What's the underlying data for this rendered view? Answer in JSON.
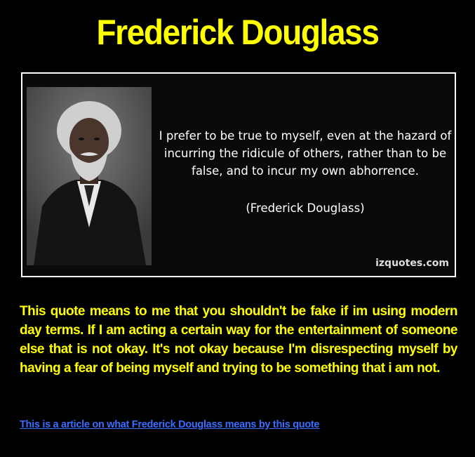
{
  "title": "Frederick Douglass",
  "quote_card": {
    "quote": "I prefer to be true to myself, even at the hazard of incurring the ridicule of others, rather than to be false, and to incur my own abhorrence.",
    "author": "(Frederick Douglass)",
    "watermark": "izquotes.com"
  },
  "commentary": "This quote means to me that you shouldn't be fake if im using modern day terms. If I am acting a certain way for the entertainment of someone else that is not okay. It's not okay because I'm disrespecting myself by having a fear of being myself and trying to be something that i am not.",
  "link": {
    "label": "This is a article on what Frederick Douglass means by this quote"
  },
  "colors": {
    "background": "#000000",
    "title": "#ffff00",
    "commentary": "#ffff00",
    "link": "#3b6cff",
    "card_border": "#ffffff"
  }
}
